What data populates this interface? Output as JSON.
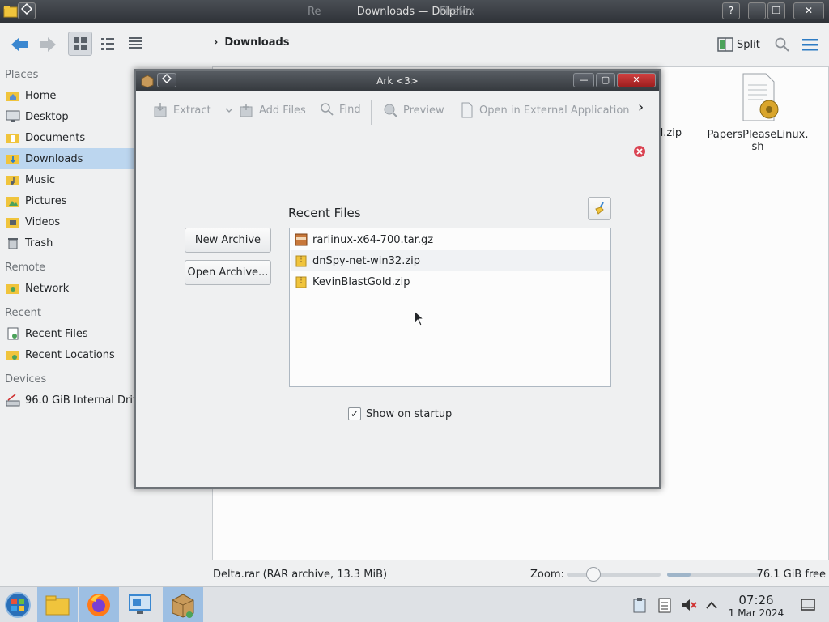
{
  "dolphin": {
    "title": "Downloads — Dolphin",
    "title_ghost": "Re",
    "title_overlap": "Firefox",
    "breadcrumb": {
      "chevron": "›",
      "location": "Downloads"
    },
    "split_label": "Split",
    "places": {
      "places_header": "Places",
      "places": [
        "Home",
        "Desktop",
        "Documents",
        "Downloads",
        "Music",
        "Pictures",
        "Videos",
        "Trash"
      ],
      "remote_header": "Remote",
      "remote": [
        "Network"
      ],
      "recent_header": "Recent",
      "recent": [
        "Recent Files",
        "Recent Locations"
      ],
      "devices_header": "Devices",
      "devices": [
        "96.0 GiB Internal Drive"
      ]
    },
    "files": {
      "partial_zip": "d.zip",
      "papers_line1": "PapersPleaseLinux.",
      "papers_line2": "sh"
    },
    "status": {
      "selection": "Delta.rar (RAR archive, 13.3 MiB)",
      "zoom_label": "Zoom:",
      "zoom_level": 0.22,
      "free_space": "76.1 GiB free",
      "space_used_fraction": 0.25
    }
  },
  "ark": {
    "title": "Ark <3>",
    "toolbar": {
      "extract": "Extract",
      "add_files": "Add Files",
      "find": "Find",
      "preview": "Preview",
      "open_external": "Open in External Application",
      "more": "›"
    },
    "new_archive": "New Archive",
    "open_archive": "Open Archive...",
    "recent_title": "Recent Files",
    "recent_files": [
      "rarlinux-x64-700.tar.gz",
      "dnSpy-net-win32.zip",
      "KevinBlastGold.zip"
    ],
    "show_on_startup": "Show on startup",
    "show_on_startup_checked": true,
    "checkmark": "✓"
  },
  "taskbar": {
    "time": "07:26",
    "date": "1 Mar 2024"
  },
  "colors": {
    "accent": "#3daee9",
    "selection": "#bcd6ef",
    "folder": "#f0c43c"
  }
}
